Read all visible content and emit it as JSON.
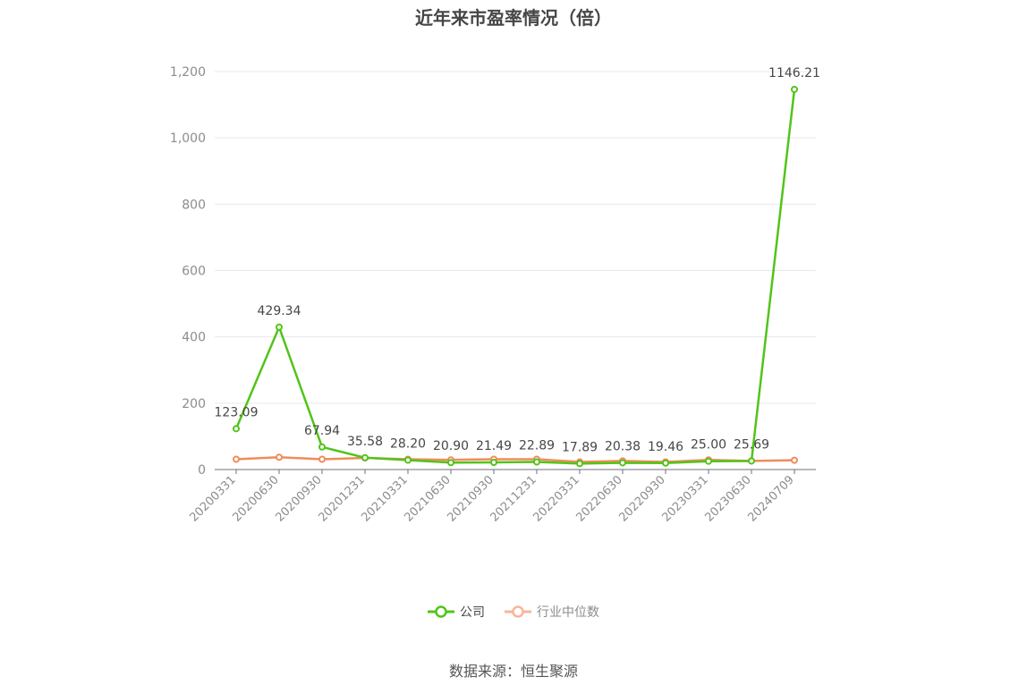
{
  "chart_data": {
    "type": "line",
    "title": "近年来市盈率情况（倍）",
    "categories": [
      "20200331",
      "20200630",
      "20200930",
      "20201231",
      "20210331",
      "20210630",
      "20210930",
      "20211231",
      "20220331",
      "20220630",
      "20220930",
      "20230331",
      "20230630",
      "20240709"
    ],
    "series": [
      {
        "name": "公司",
        "color": "#52c41a",
        "values": [
          123.09,
          429.34,
          67.94,
          35.58,
          28.2,
          20.9,
          21.49,
          22.89,
          17.89,
          20.38,
          19.46,
          25.0,
          25.69,
          1146.21
        ],
        "labels": [
          "123.09",
          "429.34",
          "67.94",
          "35.58",
          "28.20",
          "20.90",
          "21.49",
          "22.89",
          "17.89",
          "20.38",
          "19.46",
          "25.00",
          "25.69",
          "1146.21"
        ]
      },
      {
        "name": "行业中位数",
        "color": "#f08c5a",
        "values": [
          31,
          37,
          31,
          35,
          31,
          29,
          31,
          31,
          23,
          26,
          23,
          29,
          26,
          28
        ]
      }
    ],
    "ylim": [
      0,
      1200
    ],
    "yticks": [
      0,
      200,
      400,
      600,
      800,
      1000,
      1200
    ],
    "ytick_labels": [
      "0",
      "200",
      "400",
      "600",
      "800",
      "1,000",
      "1,200"
    ],
    "grid": true,
    "legend_position": "bottom-center"
  },
  "legend": {
    "company_label": "公司",
    "company_text_color": "#464646",
    "industry_label": "行业中位数",
    "industry_text_color": "#8c8c8c",
    "industry_swatch_color": "#f7b59a"
  },
  "source": "数据来源：恒生聚源"
}
